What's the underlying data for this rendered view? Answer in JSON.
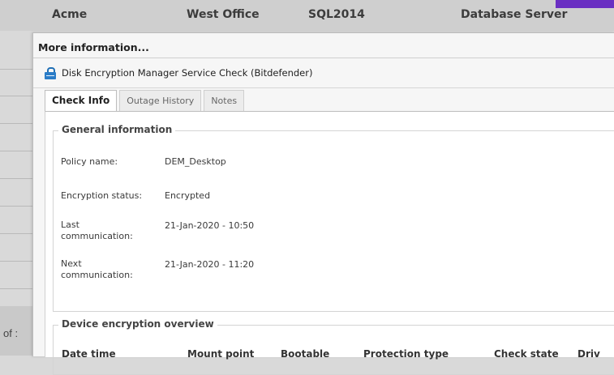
{
  "background_row": {
    "cells": [
      "Acme",
      "West Office",
      "SQL2014",
      "Database Server"
    ]
  },
  "background_footer": {
    "text": "of :"
  },
  "dialog": {
    "title": "More information...",
    "check_name": "Disk Encryption Manager Service Check (Bitdefender)",
    "tabs": [
      {
        "label": "Check Info",
        "active": true
      },
      {
        "label": "Outage History",
        "active": false
      },
      {
        "label": "Notes",
        "active": false
      }
    ],
    "general_information": {
      "legend": "General information",
      "fields": [
        {
          "label": "Policy name:",
          "value": "DEM_Desktop"
        },
        {
          "label": "Encryption status:",
          "value": "Encrypted"
        },
        {
          "label_line1": "Last",
          "label_line2": "communication:",
          "value": "21-Jan-2020 - 10:50"
        },
        {
          "label_line1": "Next",
          "label_line2": "communication:",
          "value": "21-Jan-2020 - 11:20"
        }
      ]
    },
    "device_encryption_overview": {
      "legend": "Device encryption overview",
      "columns": [
        "Date time",
        "Mount point",
        "Bootable",
        "Protection type",
        "Check state",
        "Driv"
      ]
    }
  },
  "colors": {
    "accent": "#6a2fc2",
    "icon_blue": "#2a7cc7"
  },
  "icons": {
    "check_icon": "lock-icon"
  }
}
